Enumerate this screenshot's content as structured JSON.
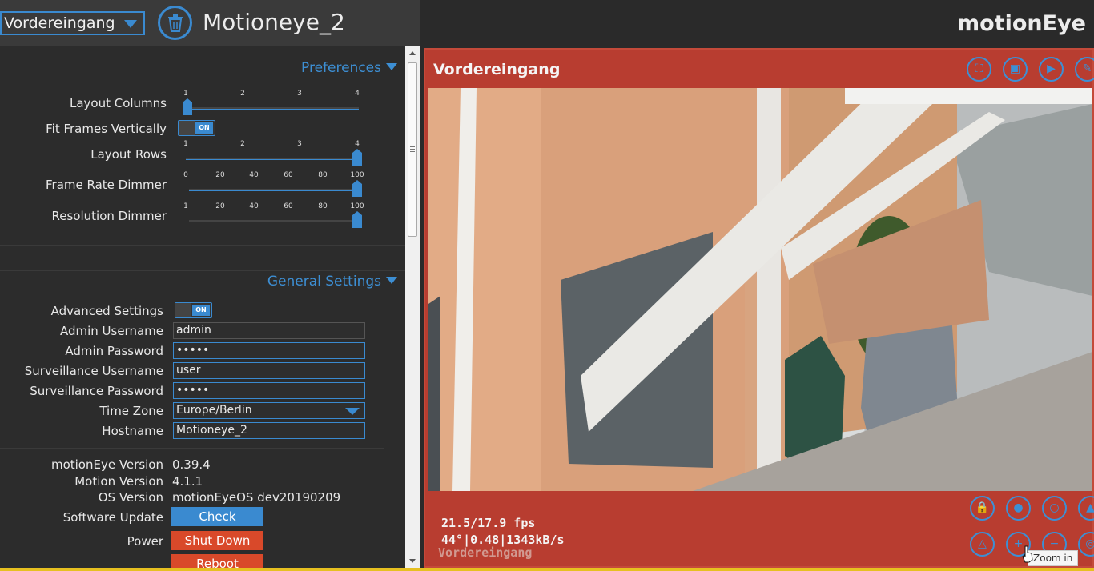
{
  "header": {
    "camera_select_value": "Vordereingang",
    "camera_title": "Motioneye_2",
    "app_title": "motionEye"
  },
  "preferences": {
    "section_title": "Preferences",
    "layout_columns": {
      "label": "Layout Columns",
      "ticks": [
        "1",
        "2",
        "3",
        "4"
      ],
      "value": 1
    },
    "fit_frames_vertically": {
      "label": "Fit Frames Vertically",
      "toggle": "ON"
    },
    "layout_rows": {
      "label": "Layout Rows",
      "ticks": [
        "1",
        "2",
        "3",
        "4"
      ],
      "value": 4
    },
    "frame_rate_dimmer": {
      "label": "Frame Rate Dimmer",
      "ticks": [
        "0",
        "20",
        "40",
        "60",
        "80",
        "100"
      ],
      "value": 100
    },
    "resolution_dimmer": {
      "label": "Resolution Dimmer",
      "ticks": [
        "1",
        "20",
        "40",
        "60",
        "80",
        "100"
      ],
      "value": 100
    }
  },
  "general": {
    "section_title": "General Settings",
    "advanced_settings": {
      "label": "Advanced Settings",
      "toggle": "ON"
    },
    "admin_username": {
      "label": "Admin Username",
      "value": "admin"
    },
    "admin_password": {
      "label": "Admin Password",
      "value": "•••••"
    },
    "surveillance_username": {
      "label": "Surveillance Username",
      "value": "user"
    },
    "surveillance_password": {
      "label": "Surveillance Password",
      "value": "•••••"
    },
    "time_zone": {
      "label": "Time Zone",
      "value": "Europe/Berlin"
    },
    "hostname": {
      "label": "Hostname",
      "value": "Motioneye_2"
    },
    "motioneye_version": {
      "label": "motionEye Version",
      "value": "0.39.4"
    },
    "motion_version": {
      "label": "Motion Version",
      "value": "4.1.1"
    },
    "os_version": {
      "label": "OS Version",
      "value": "motionEyeOS dev20190209"
    },
    "software_update": {
      "label": "Software Update",
      "button": "Check"
    },
    "power": {
      "label": "Power",
      "shutdown_button": "Shut Down",
      "reboot_button": "Reboot"
    }
  },
  "camera_frame": {
    "title": "Vordereingang",
    "fps": "21.5/17.9 fps",
    "stats": "44°|0.48|1343kB/s",
    "overlay_name": "Vordereingang",
    "tooltip": "Zoom in",
    "top_icons": [
      "fullscreen-icon",
      "picture-icon",
      "play-icon",
      "wrench-icon"
    ],
    "bottom_icons": [
      "lock-icon",
      "light-on-icon",
      "light-off-icon",
      "alarm-icon",
      "alarm-off-icon",
      "zoom-in-icon",
      "zoom-out-icon",
      "preset-icon"
    ]
  },
  "colors": {
    "accent": "#3a8ad0",
    "frame_red": "#b83d30",
    "danger": "#d9492a",
    "panel_bg": "#2c2c2c"
  }
}
